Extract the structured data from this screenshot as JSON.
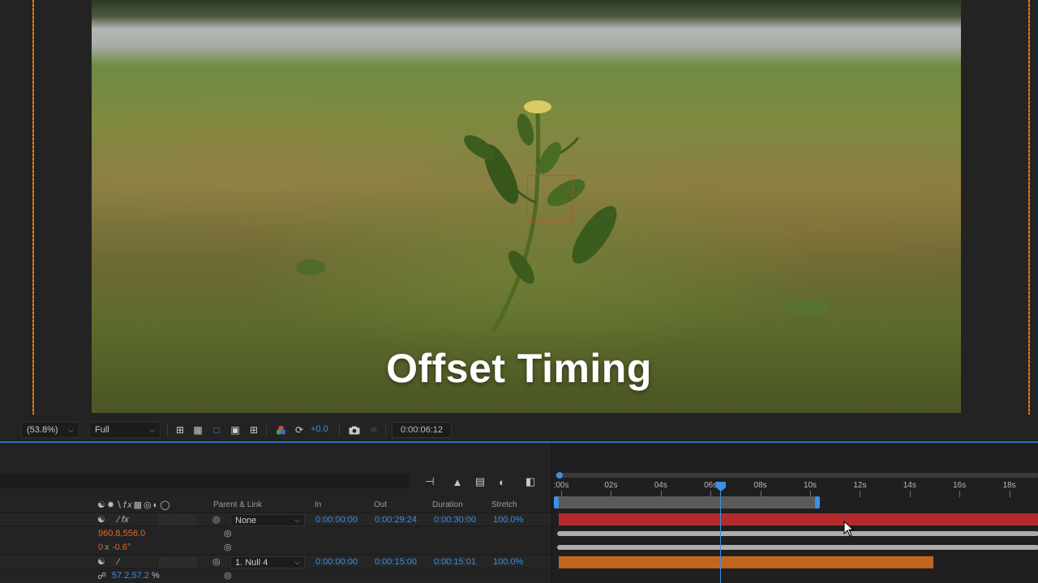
{
  "viewer": {
    "title_overlay": "Offset Timing",
    "magnification": "(53.8%)",
    "resolution": "Full",
    "exposure": "+0.0",
    "timecode": "0:00:06:12"
  },
  "timeline": {
    "columns": {
      "parent_link": "Parent & Link",
      "in": "In",
      "out": "Out",
      "duration": "Duration",
      "stretch": "Stretch"
    },
    "layers": [
      {
        "parent": "None",
        "in": "0:00:00:00",
        "out": "0:00:29:24",
        "duration": "0:00:30:00",
        "stretch": "100.0%"
      },
      {
        "parent": "1. Null 4",
        "in": "0:00:00:00",
        "out": "0:00:15:00",
        "duration": "0:00:15:01",
        "stretch": "100.0%"
      }
    ],
    "properties": {
      "position": "960.8,556.0",
      "rotation_turns": "0",
      "rotation_x": "x",
      "rotation_deg": "-0.6°",
      "scale": "57.2,57.2",
      "scale_unit": "%"
    },
    "ruler_labels": [
      ":00s",
      "02s",
      "04s",
      "06s",
      "08s",
      "10s",
      "12s",
      "14s",
      "16s",
      "18s"
    ],
    "playhead_seconds": 6.4,
    "work_area_end_seconds": 10.3
  },
  "colors": {
    "accent_blue": "#3c90e6",
    "layer_red": "#b52a2a",
    "layer_orange": "#c1661e",
    "value_orange": "#e0662b"
  },
  "icons": [
    "pixel-aspect-icon",
    "transparency-grid-icon",
    "mask-outline-icon",
    "safe-margins-icon",
    "3d-view-icon",
    "color-channel-icon",
    "reset-exposure-icon",
    "snapshot-icon",
    "show-snapshot-icon",
    "comp-flowchart-icon",
    "shy-layers-icon",
    "frame-blending-icon",
    "motion-blur-icon",
    "graph-editor-icon"
  ]
}
